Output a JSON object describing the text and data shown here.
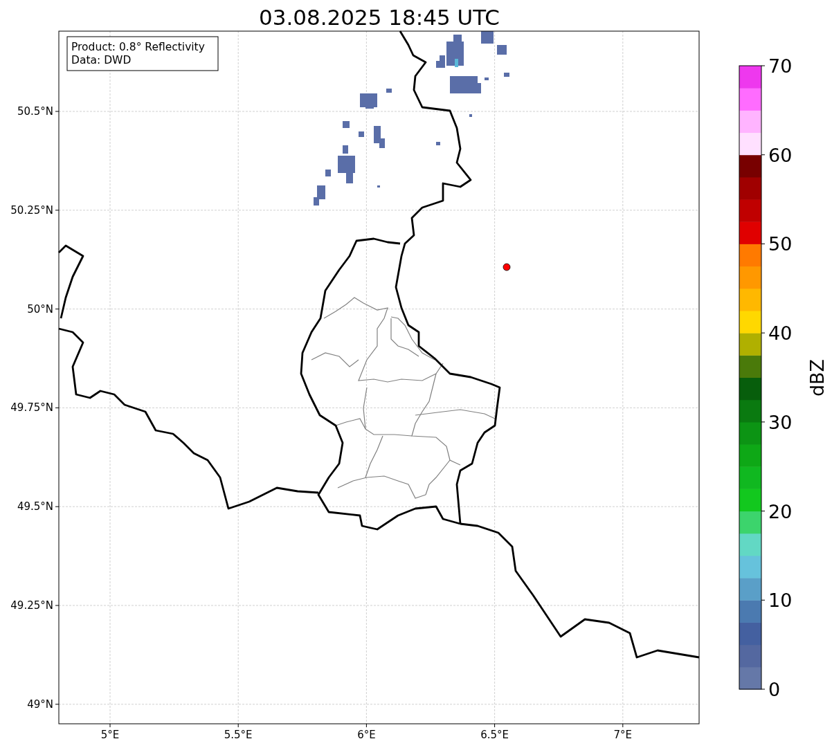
{
  "title": "03.08.2025 18:45 UTC",
  "map": {
    "info_lines": [
      "Product: 0.8° Reflectivity",
      "Data: DWD"
    ],
    "xtick_labels": [
      "5°E",
      "5.5°E",
      "6°E",
      "6.5°E",
      "7°E"
    ],
    "ytick_labels": [
      "50.5°N",
      "50.25°N",
      "50°N",
      "49.75°N",
      "49.5°N",
      "49.25°N",
      "49°N"
    ]
  },
  "colorbar": {
    "label": "dBZ",
    "tick_labels": [
      "70",
      "60",
      "50",
      "40",
      "30",
      "20",
      "10",
      "0"
    ],
    "segments": [
      {
        "color": "#6578a8"
      },
      {
        "color": "#5468a0"
      },
      {
        "color": "#4460a0"
      },
      {
        "color": "#4b7ab0"
      },
      {
        "color": "#5a9fc8"
      },
      {
        "color": "#66c2dc"
      },
      {
        "color": "#62d8c4"
      },
      {
        "color": "#3cd46c"
      },
      {
        "color": "#12c81e"
      },
      {
        "color": "#10b820"
      },
      {
        "color": "#0ea816"
      },
      {
        "color": "#0c9414"
      },
      {
        "color": "#0a7a10"
      },
      {
        "color": "#075e0c"
      },
      {
        "color": "#4a7a0a"
      },
      {
        "color": "#b0b000"
      },
      {
        "color": "#ffd800"
      },
      {
        "color": "#ffb800"
      },
      {
        "color": "#ff9800"
      },
      {
        "color": "#ff7a00"
      },
      {
        "color": "#e00000"
      },
      {
        "color": "#c00000"
      },
      {
        "color": "#a00000"
      },
      {
        "color": "#780000"
      },
      {
        "color": "#ffe0ff"
      },
      {
        "color": "#ffb4ff"
      },
      {
        "color": "#ff6cff"
      },
      {
        "color": "#ee38ee"
      }
    ]
  }
}
